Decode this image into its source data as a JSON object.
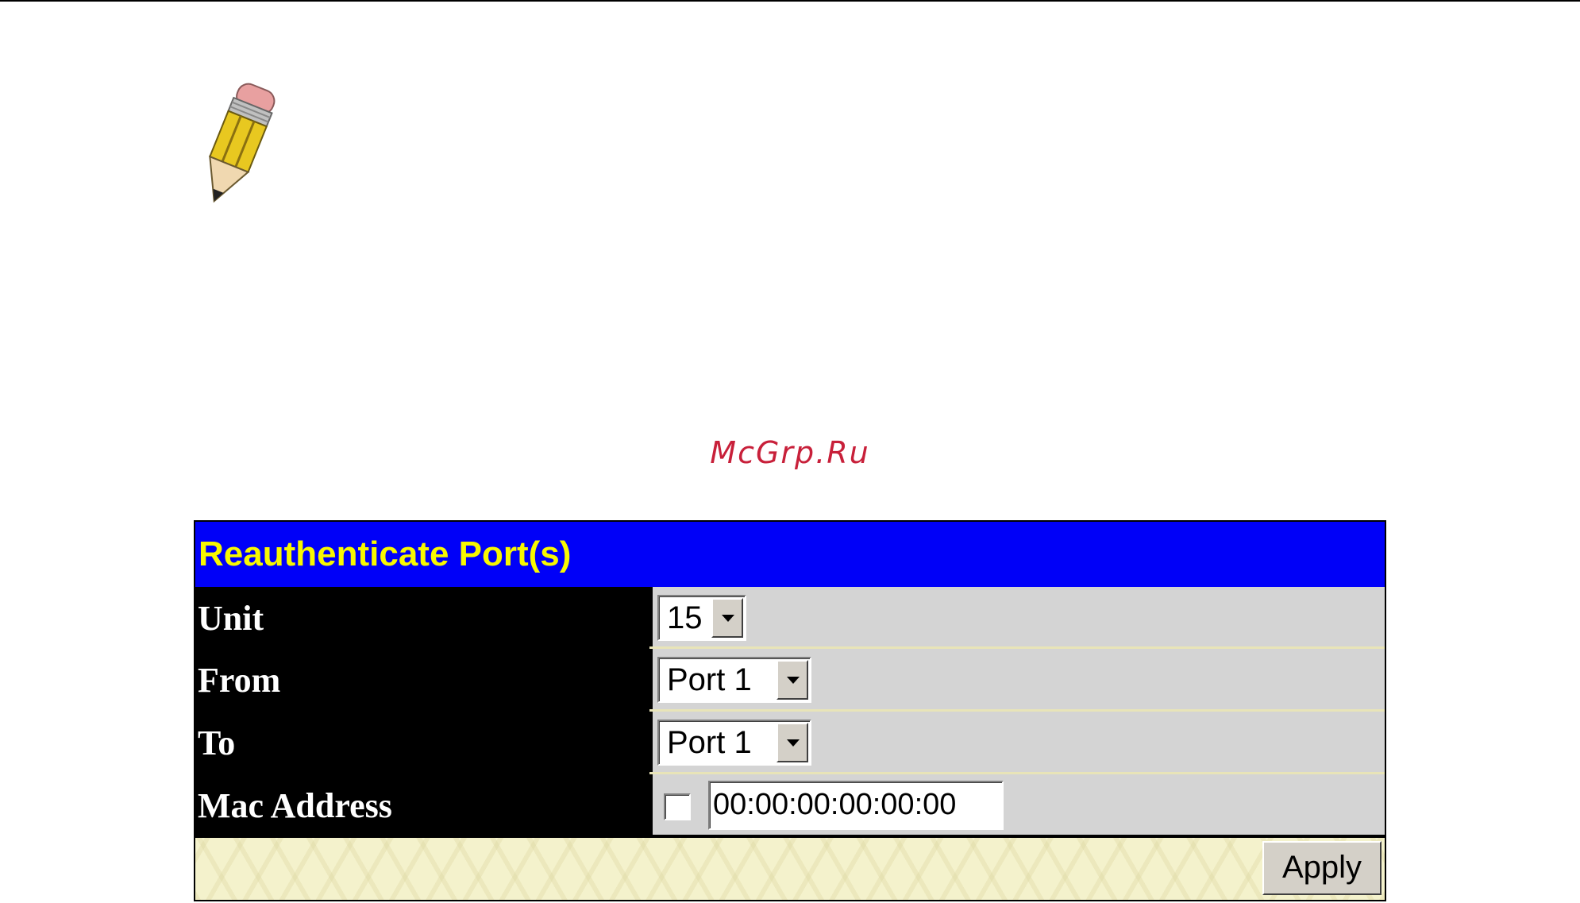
{
  "watermark": "McGrp.Ru",
  "panel": {
    "title": "Reauthenticate Port(s)",
    "rows": [
      {
        "label": "Unit",
        "value": "15"
      },
      {
        "label": "From",
        "value": "Port 1"
      },
      {
        "label": "To",
        "value": "Port 1"
      },
      {
        "label": "Mac Address",
        "value": "00:00:00:00:00:00",
        "checked": false
      }
    ],
    "apply_label": "Apply"
  },
  "colors": {
    "title_bg": "#0000f8",
    "title_text": "#f8f800",
    "label_bg": "#000000",
    "value_bg": "#d4d4d4",
    "footer_bg": "#f4f2cc",
    "watermark": "#c8203a"
  },
  "icons": {
    "note": "pencil-icon",
    "dropdown": "chevron-down-icon"
  }
}
